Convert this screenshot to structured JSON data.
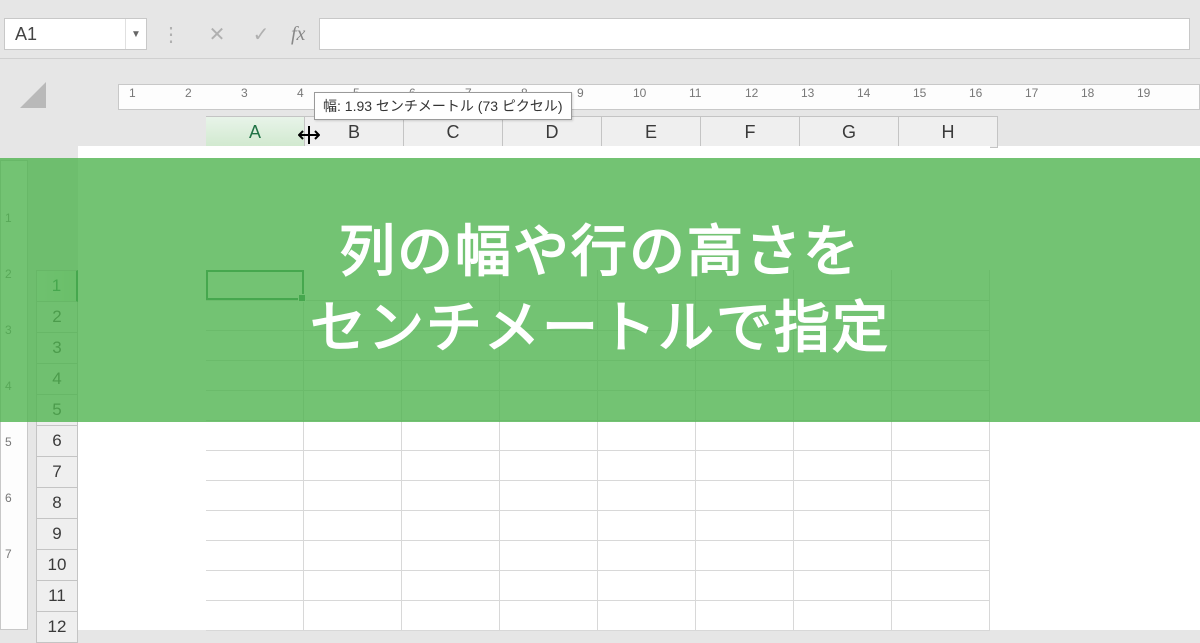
{
  "formula_bar": {
    "cell_ref": "A1",
    "fx_label": "fx",
    "cancel_glyph": "✕",
    "confirm_glyph": "✓",
    "dropdown_glyph": "▼",
    "sep_glyph": "⋮"
  },
  "ruler": {
    "h": [
      "1",
      "2",
      "3",
      "4",
      "5",
      "6",
      "7",
      "8",
      "9",
      "10",
      "11",
      "12",
      "13",
      "14",
      "15",
      "16",
      "17",
      "18",
      "19"
    ],
    "v": [
      "1",
      "2",
      "3",
      "4",
      "5",
      "6",
      "7"
    ]
  },
  "columns": [
    {
      "label": "A",
      "width": 98,
      "selected": true
    },
    {
      "label": "B",
      "width": 98,
      "selected": false
    },
    {
      "label": "C",
      "width": 98,
      "selected": false
    },
    {
      "label": "D",
      "width": 98,
      "selected": false
    },
    {
      "label": "E",
      "width": 98,
      "selected": false
    },
    {
      "label": "F",
      "width": 98,
      "selected": false
    },
    {
      "label": "G",
      "width": 98,
      "selected": false
    },
    {
      "label": "H",
      "width": 98,
      "selected": false
    }
  ],
  "rows": [
    {
      "label": "1",
      "selected": true
    },
    {
      "label": "2",
      "selected": false
    },
    {
      "label": "3",
      "selected": false
    },
    {
      "label": "4",
      "selected": false
    },
    {
      "label": "5",
      "selected": false
    },
    {
      "label": "6",
      "selected": false
    },
    {
      "label": "7",
      "selected": false
    },
    {
      "label": "8",
      "selected": false
    },
    {
      "label": "9",
      "selected": false
    },
    {
      "label": "10",
      "selected": false
    },
    {
      "label": "11",
      "selected": false
    },
    {
      "label": "12",
      "selected": false
    }
  ],
  "tooltip": {
    "text": "幅: 1.93 センチメートル (73 ピクセル)"
  },
  "resize_cursor_glyph": "↔",
  "overlay": {
    "line1": "列の幅や行の高さを",
    "line2": "センチメートルで指定"
  }
}
